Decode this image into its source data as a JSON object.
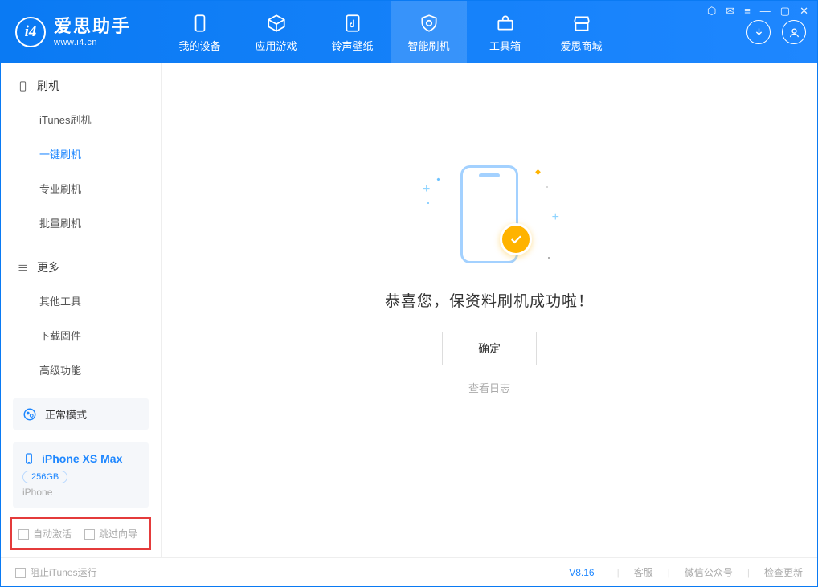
{
  "app": {
    "name": "爱思助手",
    "url": "www.i4.cn"
  },
  "topTabs": [
    {
      "label": "我的设备"
    },
    {
      "label": "应用游戏"
    },
    {
      "label": "铃声壁纸"
    },
    {
      "label": "智能刷机"
    },
    {
      "label": "工具箱"
    },
    {
      "label": "爱思商城"
    }
  ],
  "sidebar": {
    "groups": [
      {
        "title": "刷机",
        "items": [
          {
            "label": "iTunes刷机"
          },
          {
            "label": "一键刷机"
          },
          {
            "label": "专业刷机"
          },
          {
            "label": "批量刷机"
          }
        ]
      },
      {
        "title": "更多",
        "items": [
          {
            "label": "其他工具"
          },
          {
            "label": "下载固件"
          },
          {
            "label": "高级功能"
          }
        ]
      }
    ],
    "mode": "正常模式",
    "device": {
      "name": "iPhone XS Max",
      "storage": "256GB",
      "type": "iPhone"
    },
    "options": {
      "autoActivate": "自动激活",
      "skipGuide": "跳过向导"
    }
  },
  "main": {
    "successText": "恭喜您，保资料刷机成功啦！",
    "confirm": "确定",
    "viewLog": "查看日志"
  },
  "footer": {
    "blockItunes": "阻止iTunes运行",
    "version": "V8.16",
    "links": {
      "service": "客服",
      "wechat": "微信公众号",
      "update": "检查更新"
    }
  }
}
